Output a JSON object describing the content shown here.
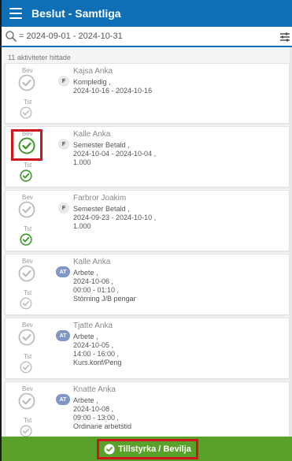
{
  "header": {
    "title": "Beslut - Samtliga"
  },
  "search": {
    "value": "= 2024-09-01 - 2024-10-31"
  },
  "results": {
    "count_text": "11 aktiviteter hittade"
  },
  "labels": {
    "bev": "Bev",
    "tst": "Tst"
  },
  "cards": [
    {
      "name": "Kajsa Anka",
      "badge": "F",
      "lines": [
        "Kompledig ,",
        "2024-10-16 - 2024-10-16"
      ],
      "bev_checked": false,
      "tst_checked": false
    },
    {
      "name": "Kalle Anka",
      "badge": "F",
      "lines": [
        "Semester Betald ,",
        "2024-10-04 - 2024-10-04 ,",
        "1.000"
      ],
      "bev_checked": true,
      "tst_checked": true
    },
    {
      "name": "Farbror Joakim",
      "badge": "F",
      "lines": [
        "Semester Betald ,",
        "2024-09-23 - 2024-10-10 ,",
        "1.000"
      ],
      "bev_checked": false,
      "tst_checked": true
    },
    {
      "name": "Kalle Anka",
      "badge": "AT",
      "lines": [
        "Arbete ,",
        "2024-10-06 ,",
        "00:00 - 01:10 ,",
        "Störning J/B pengar"
      ],
      "bev_checked": false,
      "tst_checked": false
    },
    {
      "name": "Tjatte Anka",
      "badge": "AT",
      "lines": [
        "Arbete ,",
        "2024-10-05 ,",
        "14:00 - 16:00 ,",
        "Kurs.konf/Peng"
      ],
      "bev_checked": false,
      "tst_checked": false
    },
    {
      "name": "Knatte Anka",
      "badge": "AT",
      "lines": [
        "Arbete ,",
        "2024-10-08 ,",
        "09:00 - 13:00 ,",
        "Ordinarie arbetstid"
      ],
      "bev_checked": false,
      "tst_checked": false
    }
  ],
  "footer": {
    "approve_label": "Tillstyrka / Bevilja"
  },
  "colors": {
    "header": "#0e6fb6",
    "approve": "#59a12a",
    "check_green": "#3c9a2a",
    "check_gray": "#bdbdbd",
    "highlight": "#d0161c"
  },
  "icons": {
    "menu": "hamburger-icon",
    "search": "search-icon",
    "filter": "filter-icon",
    "check": "check-circle-icon"
  }
}
